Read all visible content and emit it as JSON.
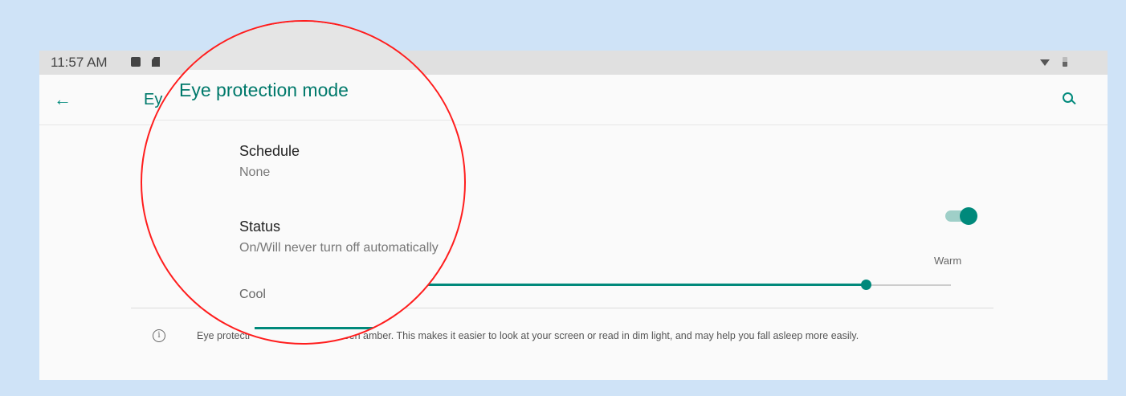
{
  "statusbar": {
    "time": "11:57 AM",
    "icons": [
      "image-icon",
      "sd-card-icon",
      "wifi-icon",
      "battery-icon"
    ]
  },
  "appbar": {
    "title": "Eye protection mode",
    "title_behind_magnifier": "Ey",
    "back_icon": "arrow-back-icon",
    "search_icon": "search-icon"
  },
  "settings": {
    "schedule": {
      "title": "Schedule",
      "value": "None"
    },
    "status": {
      "title": "Status",
      "value": "On/Will never turn off automatically",
      "enabled": true
    },
    "intensity": {
      "min_label": "Cool",
      "max_label": "Warm",
      "value_fraction": 0.84
    }
  },
  "footer": {
    "info_icon": "info-icon",
    "info_glyph": "i",
    "text_prefix": "Eye protecti",
    "text": "screen amber. This makes it easier to look at your screen or read in dim light, and may help you fall asleep more easily."
  },
  "colors": {
    "accent": "#00897b",
    "magnifier_outline": "#ff1d1d",
    "page_background": "#cfe3f7"
  }
}
